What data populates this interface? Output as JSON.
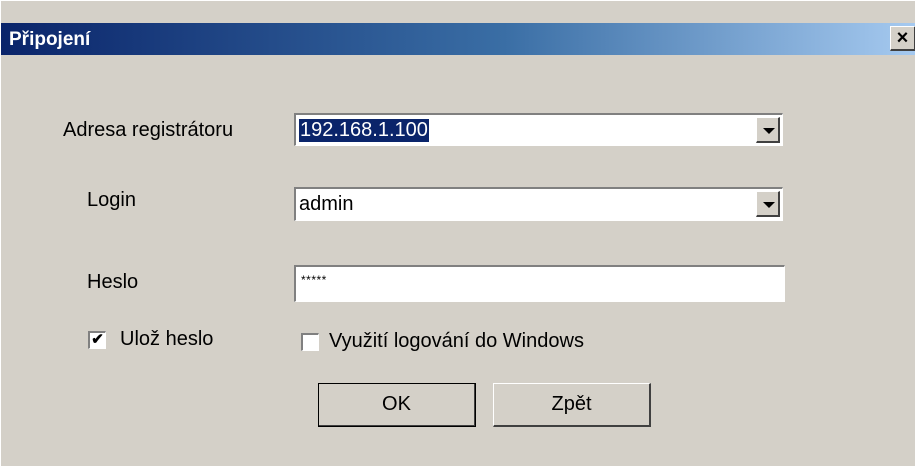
{
  "window": {
    "title": "Připojení",
    "close_glyph": "×"
  },
  "form": {
    "address_label": "Adresa registrátoru",
    "address_value": "192.168.1.100",
    "login_label": "Login",
    "login_value": "admin",
    "password_label": "Heslo",
    "password_value": "*****",
    "save_password_label": "Ulož heslo",
    "save_password_checked": true,
    "save_password_check_glyph": "✔",
    "windows_login_label": "Využití logování do Windows",
    "windows_login_checked": false
  },
  "buttons": {
    "ok_label": "OK",
    "back_label": "Zpět"
  }
}
